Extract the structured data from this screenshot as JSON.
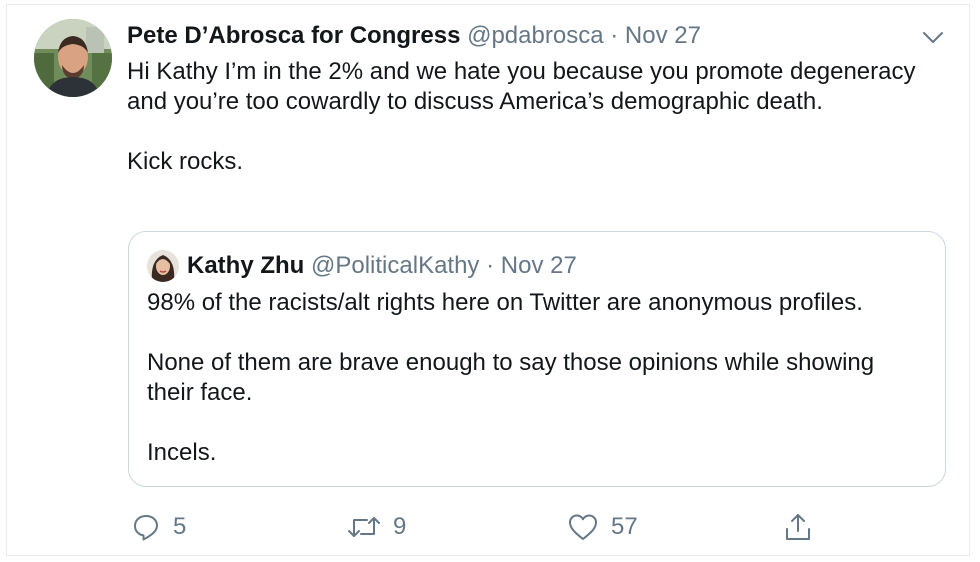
{
  "tweet": {
    "display_name": "Pete D’Abrosca for Congress",
    "handle": "@pdabrosca",
    "separator": "·",
    "date": "Nov 27",
    "text_p1": "Hi Kathy I’m in the 2% and we hate you because you promote degeneracy and you’re too cowardly to discuss America’s demographic death.",
    "text_p2": "Kick rocks.",
    "avatar_icon": "person-photo-icon",
    "menu_icon": "chevron-down-icon"
  },
  "quoted": {
    "display_name": "Kathy Zhu",
    "handle": "@PoliticalKathy",
    "separator": "·",
    "date": "Nov 27",
    "text_p1": "98% of the racists/alt rights here on Twitter are anonymous profiles.",
    "text_p2": "None of them are brave enough to say those opinions while showing their face.",
    "text_p3": "Incels."
  },
  "actions": {
    "replies": "5",
    "retweets": "9",
    "likes": "57",
    "reply_icon": "reply-icon",
    "retweet_icon": "retweet-icon",
    "like_icon": "heart-icon",
    "share_icon": "share-icon"
  },
  "colors": {
    "text_primary": "#14171a",
    "text_secondary": "#657786",
    "border": "#ccd6dd"
  }
}
